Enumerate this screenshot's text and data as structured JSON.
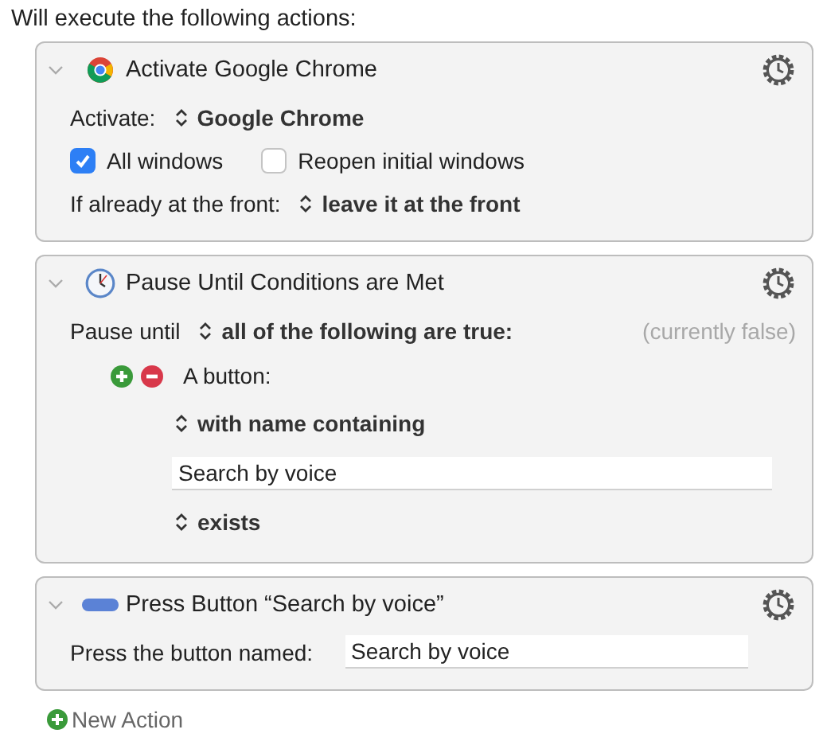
{
  "heading": "Will execute the following actions:",
  "actions": [
    {
      "kind": "chrome",
      "title": "Activate Google Chrome",
      "expanded": true,
      "rows": [
        {
          "kind": "popup",
          "label": "Activate:",
          "value": "Google Chrome"
        },
        {
          "kind": "checkboxes",
          "items": [
            {
              "label": "All windows",
              "checked": true
            },
            {
              "label": "Reopen initial windows",
              "checked": false
            }
          ]
        },
        {
          "kind": "popup",
          "label": "If already at the front:",
          "value": "leave it at the front"
        }
      ]
    },
    {
      "kind": "clock",
      "title": "Pause Until Conditions are Met",
      "expanded": true,
      "rows": [
        {
          "kind": "popup",
          "label": "Pause until",
          "value": "all of the following are true:",
          "note": "(currently false)"
        },
        {
          "kind": "condition",
          "label": "A button:"
        },
        {
          "kind": "subpopup",
          "value": "with name containing"
        },
        {
          "kind": "subfield",
          "value": "Search by voice"
        },
        {
          "kind": "subpopup",
          "value": "exists"
        }
      ]
    },
    {
      "kind": "button",
      "title": "Press Button “Search by voice”",
      "expanded": true,
      "rows": [
        {
          "kind": "field",
          "label": "Press the button named:",
          "value": "Search by voice"
        }
      ]
    }
  ],
  "new_action": "New Action"
}
